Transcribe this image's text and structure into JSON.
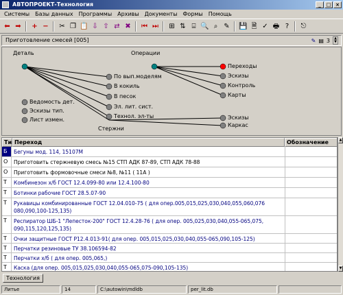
{
  "window": {
    "title": "АВТОПРОЕКТ-Технология"
  },
  "menu": [
    "Системы",
    "Базы данных",
    "Программы",
    "Архивы",
    "Документы",
    "Формы",
    "Помощь"
  ],
  "header": {
    "document_title": "Приготовление смесей  [005]",
    "page_number": "3"
  },
  "diagram": {
    "root": "Деталь",
    "operations": "Операции",
    "detail_children": [
      "По вып.моделям",
      "В кокиль",
      "В песок",
      "Эл. лит. сист.",
      "Технол. эл-ты",
      "Стержни"
    ],
    "detail_inactive": [
      "Ведомость дет.",
      "Эскизы тип.",
      "Лист измен."
    ],
    "operation_children": [
      "Переходы",
      "Эскизы",
      "Контроль",
      "Карты"
    ],
    "rods_children": [
      "Эскизы",
      "Каркас"
    ],
    "colors": {
      "active_node": "#008080",
      "selected_node": "#ff0000",
      "inactive_node": "#808080"
    }
  },
  "grid": {
    "columns": {
      "type": "Тип",
      "transition": "Переход",
      "notes": "Обозначение"
    },
    "rows": [
      {
        "type": "Б",
        "text": "Бегуны  мод.  114,  15107М",
        "selected": true
      },
      {
        "type": "О",
        "text": "Приготовить стержневую смесь №15 СТП АДК 87-89, СТП АДК 78-88"
      },
      {
        "type": "О",
        "text": "Приготовить формовочные смеси №8, №11  ( 11А  )"
      },
      {
        "type": "Т",
        "text": "Комбинезон х/б ГОСТ  12.4.099-80  или  12.4.100-80"
      },
      {
        "type": "Т",
        "text": "Ботинки рабочие ГОСТ  28.5.07-90"
      },
      {
        "type": "Т",
        "text": "Рукавицы комбинированные ГОСТ  12.04.010-75  ( для опер.005,015,025,030,040,055,060,076  080,090,100-125,135)"
      },
      {
        "type": "Т",
        "text": "Респиратор ШБ-1 \"Лепесток-200\" ГОСТ  12.4.28-76  ( для опер.  005,025,030,040,055-065,075,  090,115,120,125,135)"
      },
      {
        "type": "Т",
        "text": "Очки защитные ГОСТ Р12.4.013-91( для опер.  005,015,025,030,040,055-065,090,105-125)"
      },
      {
        "type": "Т",
        "text": "Перчатки резиновые ТУ 38.106594-82"
      },
      {
        "type": "Т",
        "text": "Перчатки х/б  ( для опер.  005,065,)"
      },
      {
        "type": "Т",
        "text": "Каска  (для опер.  005,015,025,030,040,055-065,075-090,105-135)"
      }
    ]
  },
  "tabs": [
    "Технология"
  ],
  "status": [
    "Литье",
    "14",
    "C:\\autowin\\mdldb",
    "per_lit.db"
  ]
}
